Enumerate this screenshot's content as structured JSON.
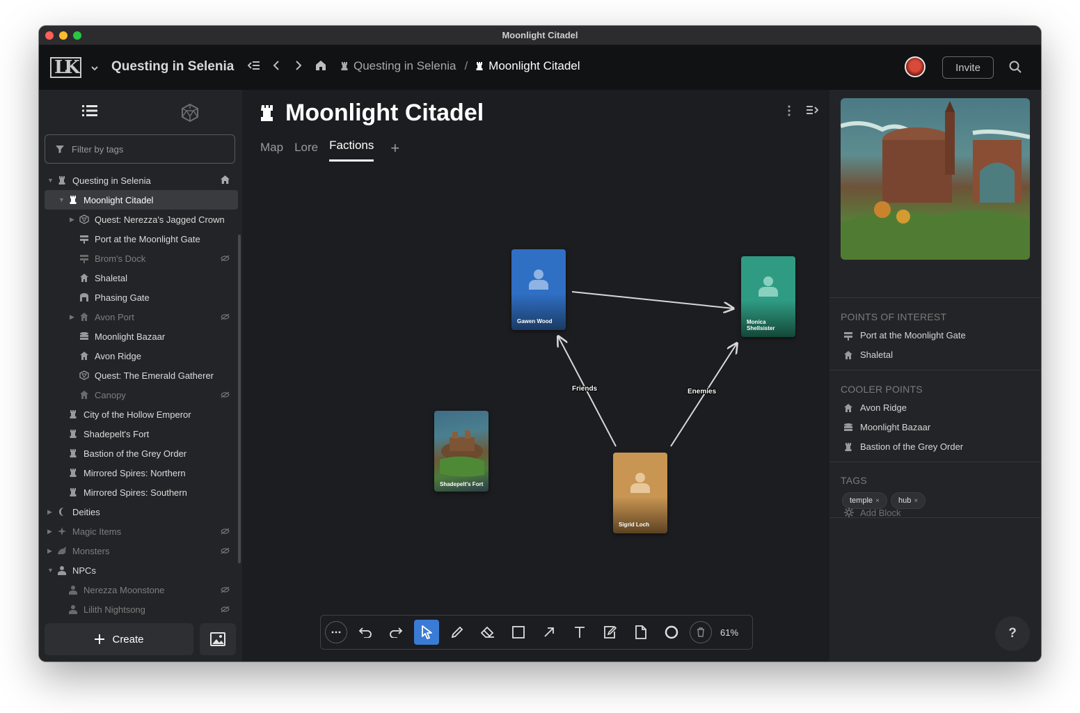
{
  "window": {
    "title": "Moonlight Citadel"
  },
  "topbar": {
    "logo_text": "LK",
    "world_name": "Questing in Selenia",
    "breadcrumbs": [
      "Questing in Selenia",
      "Moonlight Citadel"
    ],
    "breadcrumb_separator": "/",
    "invite_label": "Invite"
  },
  "sidebar": {
    "filter_placeholder": "Filter by tags",
    "tree": [
      {
        "label": "Questing in Selenia",
        "icon": "rook-icon",
        "depth": 0,
        "expanded": true,
        "home": true
      },
      {
        "label": "Moonlight Citadel",
        "icon": "rook-icon",
        "depth": 1,
        "expanded": true,
        "selected": true
      },
      {
        "label": "Quest: Nerezza's Jagged Crown",
        "icon": "d20-icon",
        "depth": 2,
        "collapsed": true
      },
      {
        "label": "Port at the Moonlight Gate",
        "icon": "signpost-icon",
        "depth": 2
      },
      {
        "label": "Brom's Dock",
        "icon": "signpost-icon",
        "depth": 2,
        "hidden": true
      },
      {
        "label": "Shaletal",
        "icon": "house-icon",
        "depth": 2
      },
      {
        "label": "Phasing Gate",
        "icon": "gate-icon",
        "depth": 2
      },
      {
        "label": "Avon Port",
        "icon": "house-icon",
        "depth": 2,
        "collapsed": true,
        "hidden": true
      },
      {
        "label": "Moonlight Bazaar",
        "icon": "coins-icon",
        "depth": 2
      },
      {
        "label": "Avon Ridge",
        "icon": "house-icon",
        "depth": 2
      },
      {
        "label": "Quest: The Emerald Gatherer",
        "icon": "d20-icon",
        "depth": 2
      },
      {
        "label": "Canopy",
        "icon": "house-icon",
        "depth": 2,
        "hidden": true
      },
      {
        "label": "City of the Hollow Emperor",
        "icon": "rook-icon",
        "depth": 1
      },
      {
        "label": "Shadepelt's Fort",
        "icon": "rook-icon",
        "depth": 1
      },
      {
        "label": "Bastion of the Grey Order",
        "icon": "rook-icon",
        "depth": 1
      },
      {
        "label": "Mirrored Spires: Northern",
        "icon": "rook-icon",
        "depth": 1
      },
      {
        "label": "Mirrored Spires: Southern",
        "icon": "rook-icon",
        "depth": 1
      },
      {
        "label": "Deities",
        "icon": "moon-icon",
        "depth": 0,
        "collapsed": true
      },
      {
        "label": "Magic Items",
        "icon": "sparkle-icon",
        "depth": 0,
        "collapsed": true,
        "hidden": true
      },
      {
        "label": "Monsters",
        "icon": "monster-icon",
        "depth": 0,
        "collapsed": true,
        "hidden": true
      },
      {
        "label": "NPCs",
        "icon": "person-icon",
        "depth": 0,
        "expanded": true
      },
      {
        "label": "Nerezza Moonstone",
        "icon": "person-icon",
        "depth": 1,
        "hidden": true
      },
      {
        "label": "Lilith Nightsong",
        "icon": "person-icon",
        "depth": 1,
        "hidden": true
      }
    ],
    "create_label": "Create"
  },
  "main": {
    "title": "Moonlight Citadel",
    "tabs": [
      "Map",
      "Lore",
      "Factions"
    ],
    "active_tab": "Factions",
    "canvas": {
      "cards": {
        "gawen": "Gawen Wood",
        "monica": "Monica Shellsister",
        "sigrid": "Sigrid Loch",
        "shadepelt": "Shadepelt's Fort"
      },
      "edges": {
        "friends": "Friends",
        "enemies": "Enemies"
      }
    },
    "toolbar": {
      "tools": [
        "more",
        "undo",
        "redo",
        "select",
        "pencil",
        "eraser",
        "rectangle",
        "arrow",
        "text",
        "note",
        "page",
        "circle",
        "delete"
      ],
      "active_tool": "select",
      "zoom": "61%"
    }
  },
  "right_panel": {
    "sections": [
      {
        "title": "POINTS OF INTEREST",
        "items": [
          {
            "label": "Port at the Moonlight Gate",
            "icon": "signpost-icon"
          },
          {
            "label": "Shaletal",
            "icon": "house-icon"
          }
        ]
      },
      {
        "title": "COOLER POINTS",
        "items": [
          {
            "label": "Avon Ridge",
            "icon": "house-icon"
          },
          {
            "label": "Moonlight Bazaar",
            "icon": "coins-icon"
          },
          {
            "label": "Bastion of the Grey Order",
            "icon": "rook-icon"
          }
        ]
      }
    ],
    "tags_title": "TAGS",
    "tags": [
      "temple",
      "hub"
    ],
    "add_block_label": "Add Block",
    "help_label": "?"
  },
  "colors": {
    "accent": "#3a7bd5",
    "card_blue": "#2f6fc4",
    "card_teal": "#2f9b83",
    "card_tan": "#c89552"
  }
}
